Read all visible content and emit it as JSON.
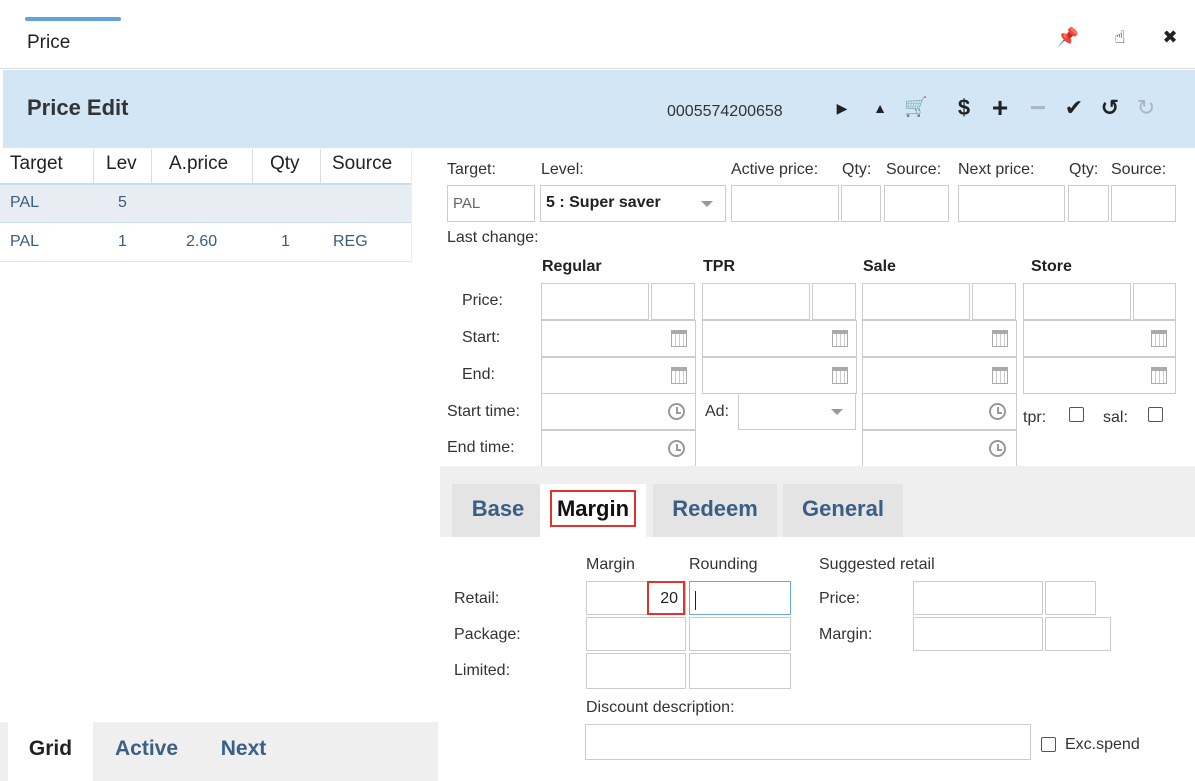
{
  "window": {
    "title": "Price",
    "controls": [
      "pin-icon",
      "touch-icon",
      "close-icon"
    ]
  },
  "header": {
    "title": "Price Edit",
    "barcode": "0005574200658",
    "toolbar": [
      "next-icon",
      "up-icon",
      "cart-icon",
      "dollar-icon",
      "plus-icon",
      "minus-icon",
      "check-icon",
      "undo-icon",
      "refresh-icon"
    ]
  },
  "grid": {
    "columns": [
      "Target",
      "Lev",
      "A.price",
      "Qty",
      "Source"
    ],
    "rows": [
      {
        "target": "PAL",
        "lev": "5",
        "aprice": "",
        "qty": "",
        "source": ""
      },
      {
        "target": "PAL",
        "lev": "1",
        "aprice": "2.60",
        "qty": "1",
        "source": "REG"
      }
    ]
  },
  "left_tabs": [
    "Grid",
    "Active",
    "Next"
  ],
  "form": {
    "labels": {
      "target": "Target:",
      "level": "Level:",
      "active_price": "Active price:",
      "qty1": "Qty:",
      "source1": "Source:",
      "next_price": "Next price:",
      "qty2": "Qty:",
      "source2": "Source:",
      "last_change": "Last change:",
      "price": "Price:",
      "start": "Start:",
      "end": "End:",
      "start_time": "Start time:",
      "end_time": "End time:",
      "ad": "Ad:",
      "tpr": "tpr:",
      "sal": "sal:"
    },
    "target_value": "PAL",
    "level_value": "5 : Super saver",
    "sections": [
      "Regular",
      "TPR",
      "Sale",
      "Store"
    ]
  },
  "tabs": [
    "Base",
    "Margin",
    "Redeem",
    "General"
  ],
  "margin": {
    "col_margin": "Margin",
    "col_rounding": "Rounding",
    "col_suggested": "Suggested retail",
    "retail": "Retail:",
    "package": "Package:",
    "limited": "Limited:",
    "retail_margin_value": "20",
    "sug_price": "Price:",
    "sug_margin": "Margin:",
    "discount_description": "Discount description:",
    "exc_spend": "Exc.spend"
  }
}
